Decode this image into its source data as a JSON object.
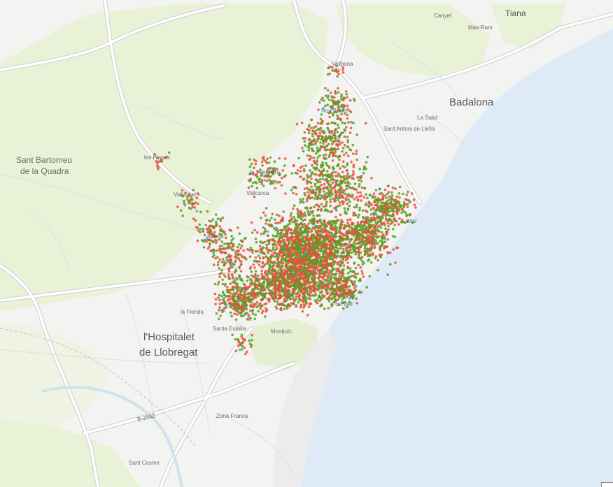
{
  "map": {
    "colors": {
      "land": "#f3f3f1",
      "park": "#e9f1d6",
      "sea": "#deebf7",
      "road": "#ffffff",
      "road_casing": "#d0d0d0",
      "point_red": "#e8503e",
      "point_green": "#4aa51e",
      "point_blue": "#3ab0e6"
    },
    "labels": {
      "tiana": "Tiana",
      "canyet": "Canyet",
      "mas_ram": "Mas-Ram",
      "vallbona": "Vallbona",
      "badalona": "Badalona",
      "nou_barris": "Nou Barris",
      "la_salut": "La Salut",
      "sant_antoni_llefia": "Sant Antoni de Llefià",
      "sant_bartomeu_1": "Sant Bartomeu",
      "sant_bartomeu_2": "de la Quadra",
      "les_planes": "les Planes",
      "la_teixonera": "la Teixonera",
      "vallvidrera": "Vallvidrera",
      "vallcarca": "Vallcarca",
      "sarria": "Sarrià",
      "el_poblenou": "Mar",
      "port_vell": "Port Vell",
      "la_florida": "la Florida",
      "santa_eulalia": "Santa Eulàlia",
      "montjuic": "Montjuïc",
      "hospitalet_1": "l'Hospitalet",
      "hospitalet_2": "de Llobregat",
      "road_b250z": "B-250Z",
      "zona_franca": "Zona Franca",
      "sant_cosme": "Sant Cosme"
    }
  }
}
